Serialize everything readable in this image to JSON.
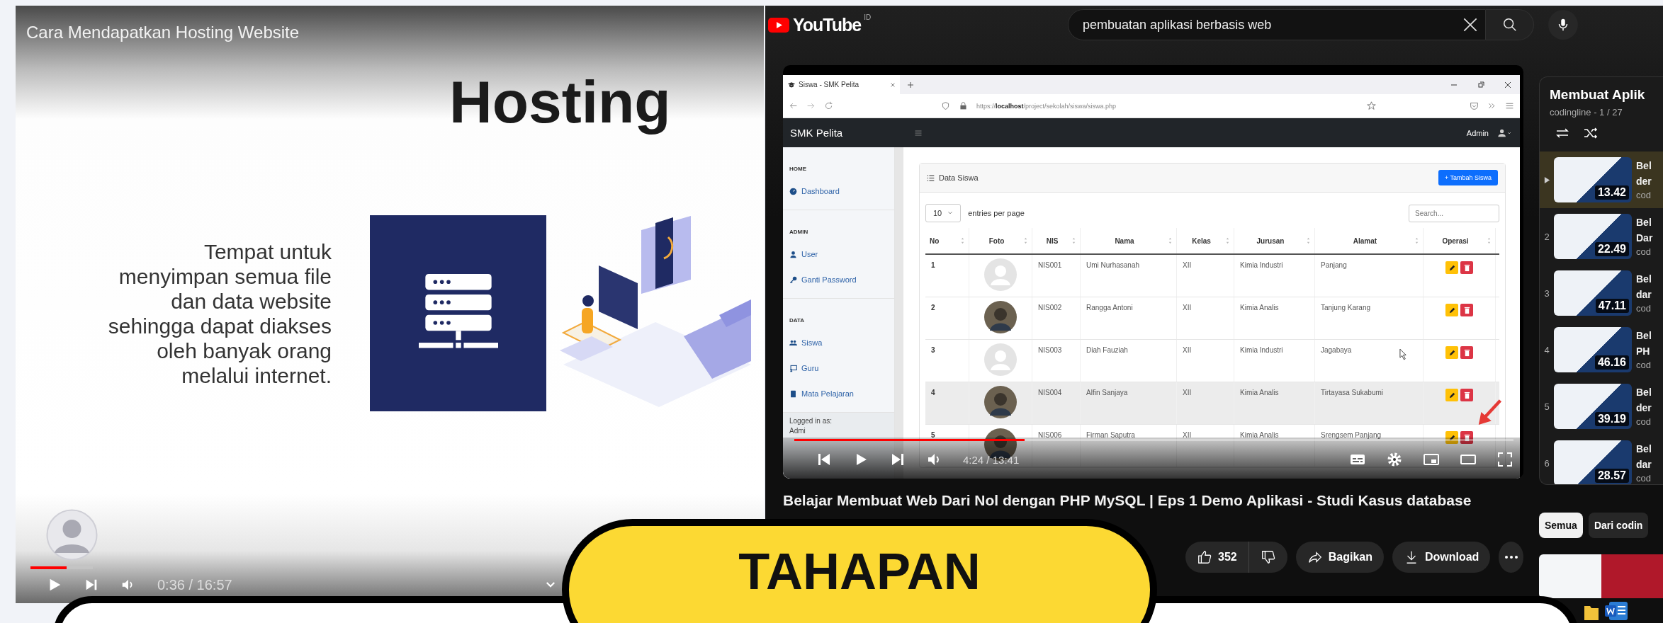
{
  "left_player": {
    "title": "Cara Mendapatkan Hosting Website",
    "slide": {
      "heading": "Hosting",
      "body_lines": [
        "Tempat untuk",
        "menyimpan semua file",
        "dan data website",
        "sehingga dapat diakses",
        "oleh banyak orang",
        "melalui internet."
      ]
    },
    "progress": {
      "level": 0.58
    },
    "time": "0:36 / 16:57"
  },
  "youtube": {
    "logo": "YouTube",
    "region": "ID",
    "search": {
      "value": "pembuatan aplikasi berbasis web"
    },
    "player": {
      "browser": {
        "tab": "Siswa - SMK Pelita",
        "url": "https://**localhost**/project/sekolah/siswa/siswa.php",
        "app": {
          "brand": "SMK Pelita",
          "user": "Admin",
          "sidebar": [
            {
              "heading": "HOME",
              "items": [
                {
                  "label": "Dashboard",
                  "kind": "dashboard"
                }
              ]
            },
            {
              "heading": "ADMIN",
              "items": [
                {
                  "label": "User",
                  "kind": "user"
                },
                {
                  "label": "Ganti Password",
                  "kind": "key"
                }
              ]
            },
            {
              "heading": "DATA",
              "items": [
                {
                  "label": "Siswa",
                  "kind": "users"
                },
                {
                  "label": "Guru",
                  "kind": "board"
                },
                {
                  "label": "Mata Pelajaran",
                  "kind": "book"
                }
              ]
            }
          ],
          "footer": {
            "caption": "Logged in as:",
            "user": "Admi"
          },
          "card": {
            "title": "Data Siswa",
            "add_button": "+ Tambah Siswa",
            "page_size": "10",
            "page_size_label": "entries per page",
            "search_placeholder": "Search...",
            "columns": [
              "No",
              "Foto",
              "NIS",
              "Nama",
              "Kelas",
              "Jurusan",
              "Alamat",
              "Operasi"
            ],
            "rows": [
              {
                "no": "1",
                "kind": "default",
                "nis": "NIS001",
                "nama": "Umi Nurhasanah",
                "kelas": "XII",
                "jurusan": "Kimia Industri",
                "alamat": "Panjang",
                "hovered": false
              },
              {
                "no": "2",
                "kind": "picture",
                "nis": "NIS002",
                "nama": "Rangga Antoni",
                "kelas": "XII",
                "jurusan": "Kimia Analis",
                "alamat": "Tanjung Karang",
                "hovered": false
              },
              {
                "no": "3",
                "kind": "default",
                "nis": "NIS003",
                "nama": "Diah Fauziah",
                "kelas": "XII",
                "jurusan": "Kimia Industri",
                "alamat": "Jagabaya",
                "hovered": false
              },
              {
                "no": "4",
                "kind": "picture",
                "nis": "NIS004",
                "nama": "Alfin Sanjaya",
                "kelas": "XII",
                "jurusan": "Kimia Analis",
                "alamat": "Tirtayasa Sukabumi",
                "hovered": true
              },
              {
                "no": "5",
                "kind": "picture",
                "nis": "NIS006",
                "nama": "Firman Saputra",
                "kelas": "XII",
                "jurusan": "Kimia Analis",
                "alamat": "Srengsem Panjang",
                "hovered": false
              }
            ]
          }
        }
      },
      "progress": {
        "level": 0.32
      },
      "time": "4:24 / 13:41"
    },
    "video_title": "Belajar Membuat Web Dari Nol dengan PHP MySQL | Eps 1 Demo Aplikasi - Studi Kasus database",
    "actions": {
      "likes": "352",
      "share": "Bagikan",
      "download": "Download"
    },
    "playlist": {
      "title": "Membuat Aplik",
      "meta": "codingline - 1 / 27",
      "items": [
        {
          "selected": true,
          "duration": "13.42",
          "title_lines": [
            "Bel",
            "der"
          ],
          "channel": "cod"
        },
        {
          "index": "2",
          "selected": false,
          "duration": "22.49",
          "title_lines": [
            "Bel",
            "Dar"
          ],
          "channel": "cod"
        },
        {
          "index": "3",
          "selected": false,
          "duration": "47.11",
          "title_lines": [
            "Bel",
            "dar"
          ],
          "channel": "cod"
        },
        {
          "index": "4",
          "selected": false,
          "duration": "46.16",
          "title_lines": [
            "Bel",
            "PH"
          ],
          "channel": "cod"
        },
        {
          "index": "5",
          "selected": false,
          "duration": "39.19",
          "title_lines": [
            "Bel",
            "der"
          ],
          "channel": "cod"
        },
        {
          "index": "6",
          "selected": false,
          "duration": "28.57",
          "title_lines": [
            "Bel",
            "dar"
          ],
          "channel": "cod"
        }
      ]
    },
    "chips": [
      {
        "label": "Semua",
        "selected": true
      },
      {
        "label": "Dari codin",
        "selected": false
      }
    ]
  },
  "banner": {
    "label": "TAHAPAN"
  }
}
